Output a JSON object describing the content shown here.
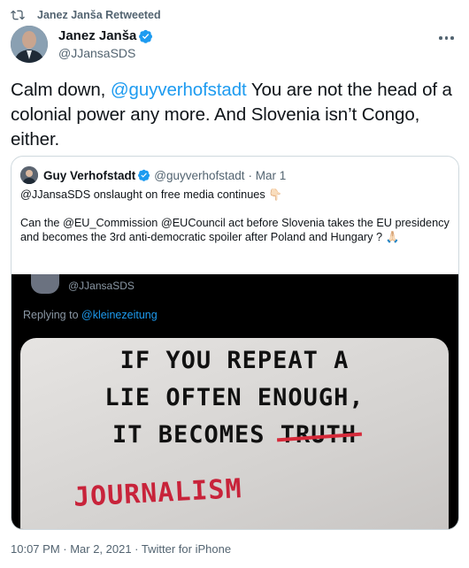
{
  "retweet": {
    "icon": "retweet-icon",
    "label": "Janez Janša Retweeted"
  },
  "author": {
    "name": "Janez Janša",
    "handle": "@JJansaSDS",
    "verified_icon": "verified-badge-icon"
  },
  "more_icon": "more-icon",
  "tweet": {
    "pre": "Calm down, ",
    "mention": "@guyverhofstadt",
    "post": " You are not the head of a colonial power any more. And Slovenia isn’t Congo, either."
  },
  "quote": {
    "name": "Guy Verhofstadt",
    "handle": "@guyverhofstadt",
    "date": "· Mar 1",
    "line1": "@JJansaSDS onslaught on free media continues 👇🏻",
    "line2": "Can the @EU_Commission @EUCouncil act before Slovenia takes the EU presidency and becomes the 3rd anti-democratic spoiler after Poland and Hungary ? 🙏🏻"
  },
  "image": {
    "handle": "@JJansaSDS",
    "replying_prefix": "Replying to ",
    "replying_mention": "@kleinezeitung",
    "sign_line1": "IF YOU REPEAT A",
    "sign_line2": "LIE OFTEN ENOUGH,",
    "sign_line3_prefix": "IT BECOMES ",
    "sign_struck": "TRUTH",
    "sign_correction": "JOURNALISM"
  },
  "footer": {
    "meta": "10:07 PM · Mar 2, 2021 · Twitter for iPhone"
  },
  "colors": {
    "accent": "#1d9bf0",
    "muted": "#536471",
    "text": "#0f1419",
    "strike": "#d62a3a"
  }
}
